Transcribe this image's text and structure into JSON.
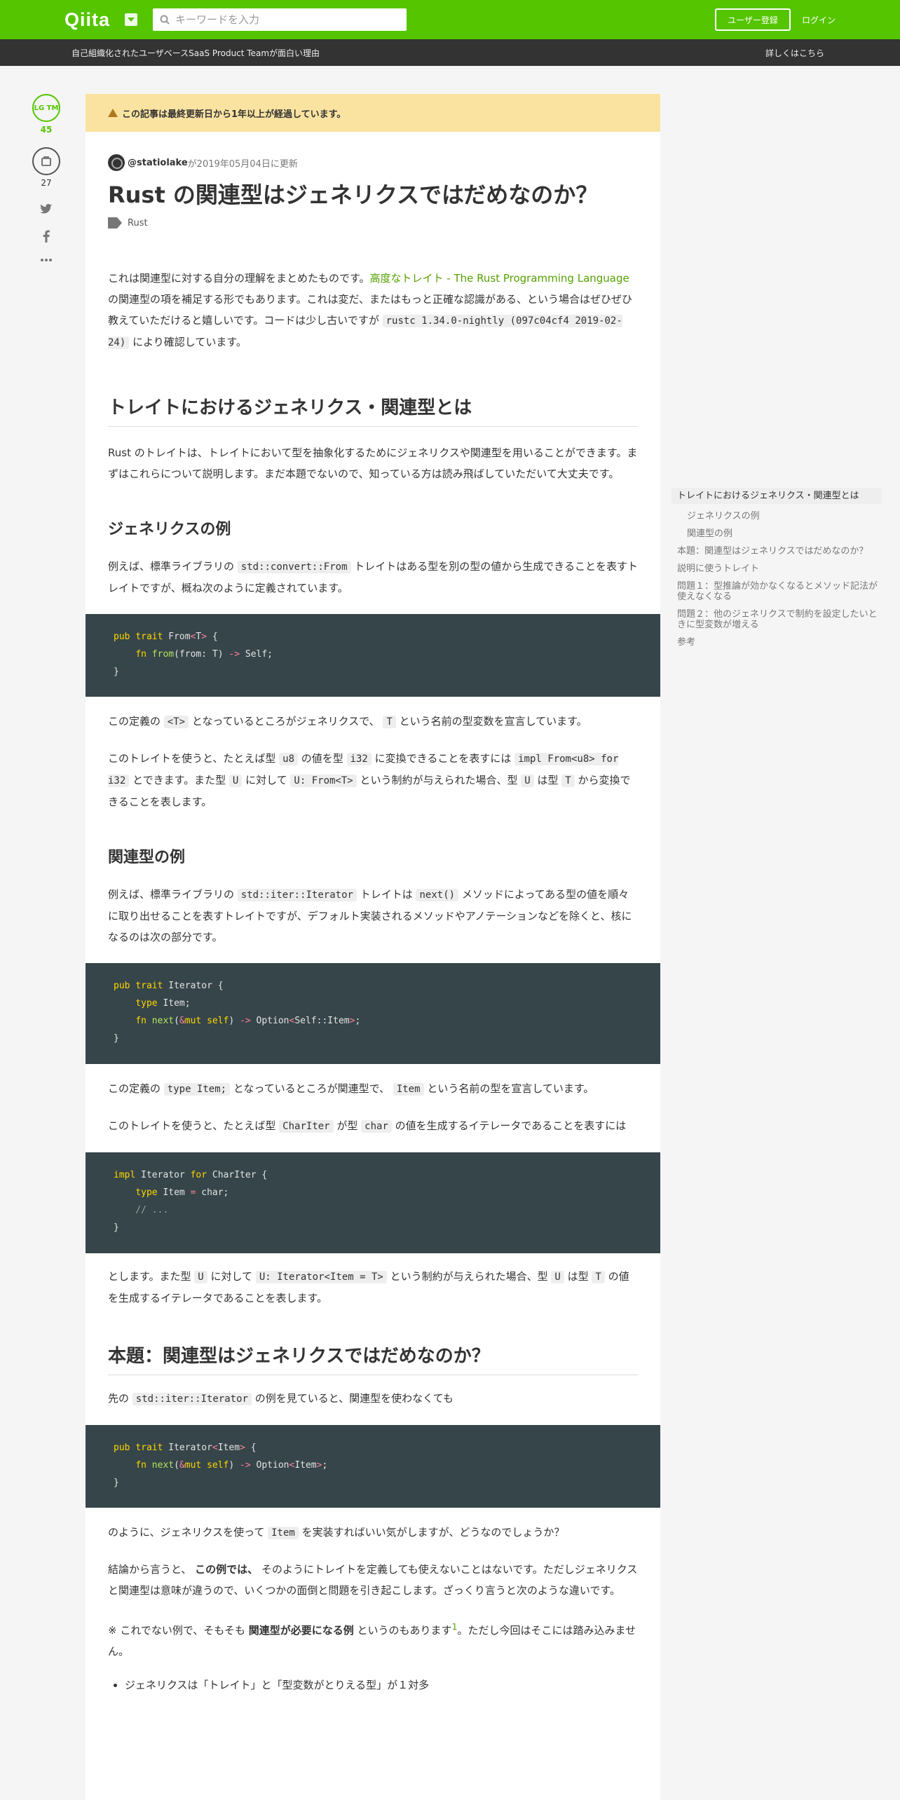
{
  "header": {
    "logo": "Qiita",
    "search_placeholder": "キーワードを入力",
    "signup": "ユーザー登録",
    "login": "ログイン"
  },
  "subbar": {
    "promo": "自己組織化されたユーザベースSaaS Product Teamが面白い理由",
    "more": "詳しくはこちら"
  },
  "sidebar": {
    "lgtm_label": "LG TM",
    "lgtm_count": "45",
    "stock_count": "27"
  },
  "article": {
    "warning": "この記事は最終更新日から1年以上が経過しています。",
    "author": "@statiolake",
    "updated": "が2019年05月04日に更新",
    "title": "Rust の関連型はジェネリクスではだめなのか？",
    "tag": "Rust",
    "intro": {
      "t1": "これは関連型に対する自分の理解をまとめたものです。",
      "link": "高度なトレイト - The Rust Programming Language",
      "t2": "の関連型の項を補足する形でもあります。これは変だ、またはもっと正確な認識がある、という場合はぜひぜひ教えていただけると嬉しいです。コードは少し古いですが ",
      "code": "rustc 1.34.0-nightly (097c04cf4 2019-02-24)",
      "t3": " により確認しています。"
    },
    "h2_1": "トレイトにおけるジェネリクス・関連型とは",
    "p_1": "Rust のトレイトは、トレイトにおいて型を抽象化するためにジェネリクスや関連型を用いることができます。まずはこれらについて説明します。まだ本題でないので、知っている方は読み飛ばしていただいて大丈夫です。",
    "h3_1": "ジェネリクスの例",
    "p_2a": "例えば、標準ライブラリの ",
    "p_2code": "std::convert::From",
    "p_2b": " トレイトはある型を別の型の値から生成できることを表すトレイトですが、概ね次のように定義されています。",
    "p_3a": "この定義の ",
    "p_3code1": "<T>",
    "p_3b": " となっているところがジェネリクスで、 ",
    "p_3code2": "T",
    "p_3c": " という名前の型変数を宣言しています。",
    "p_4a": "このトレイトを使うと、たとえば型 ",
    "p_4c1": "u8",
    "p_4b": " の値を型 ",
    "p_4c2": "i32",
    "p_4c": " に変換できることを表すには ",
    "p_4c3": "impl From<u8> for i32",
    "p_4d": " とできます。また型 ",
    "p_4c4": "U",
    "p_4e": " に対して ",
    "p_4c5": "U: From<T>",
    "p_4f": " という制約が与えられた場合、型 ",
    "p_4c6": "U",
    "p_4g": " は型 ",
    "p_4c7": "T",
    "p_4h": " から変換できることを表します。",
    "h3_2": "関連型の例",
    "p_5a": "例えば、標準ライブラリの ",
    "p_5c1": "std::iter::Iterator",
    "p_5b": " トレイトは ",
    "p_5c2": "next()",
    "p_5c": " メソッドによってある型の値を順々に取り出せることを表すトレイトですが、デフォルト実装されるメソッドやアノテーションなどを除くと、核になるのは次の部分です。",
    "p_6a": "この定義の ",
    "p_6c1": "type Item;",
    "p_6b": " となっているところが関連型で、 ",
    "p_6c2": "Item",
    "p_6c": " という名前の型を宣言しています。",
    "p_7a": "このトレイトを使うと、たとえば型 ",
    "p_7c1": "CharIter",
    "p_7b": " が型 ",
    "p_7c2": "char",
    "p_7c": " の値を生成するイテレータであることを表すには",
    "p_8a": "とします。また型 ",
    "p_8c1": "U",
    "p_8b": " に対して ",
    "p_8c2": "U: Iterator<Item = T>",
    "p_8c": " という制約が与えられた場合、型 ",
    "p_8c3": "U",
    "p_8d": " は型 ",
    "p_8c4": "T",
    "p_8e": " の値を生成するイテレータであることを表します。",
    "h2_2": "本題：関連型はジェネリクスではだめなのか？",
    "p_9a": "先の ",
    "p_9c1": "std::iter::Iterator",
    "p_9b": " の例を見ていると、関連型を使わなくても",
    "p_10a": "のように、ジェネリクスを使って ",
    "p_10c1": "Item",
    "p_10b": " を実装すればいい気がしますが、どうなのでしょうか？",
    "p_11a": "結論から言うと、 ",
    "p_11b": "この例では、",
    "p_11c": " そのようにトレイトを定義しても使えないことはないです。ただしジェネリクスと関連型は意味が違うので、いくつかの面倒と問題を引き起こします。ざっくり言うと次のような違いです。",
    "p_12a": "※ これでない例で、そもそも ",
    "p_12b": "関連型が必要になる例",
    "p_12c": " というのもあります",
    "p_12sup": "1",
    "p_12d": "。ただし今回はそこには踏み込みません。",
    "li_1": "ジェネリクスは「トレイト」と「型変数がとりえる型」が１対多"
  },
  "toc": [
    "トレイトにおけるジェネリクス・関連型とは",
    "ジェネリクスの例",
    "関連型の例",
    "本題：関連型はジェネリクスではだめなのか？",
    "説明に使うトレイト",
    "問題１：型推論が効かなくなるとメソッド記法が使えなくなる",
    "問題２：他のジェネリクスで制約を設定したいときに型変数が増える",
    "参考"
  ],
  "colors": {
    "brand": "#55c500",
    "subbar": "#333333",
    "code_bg": "#364549",
    "warning_bg": "#fae3a1"
  }
}
